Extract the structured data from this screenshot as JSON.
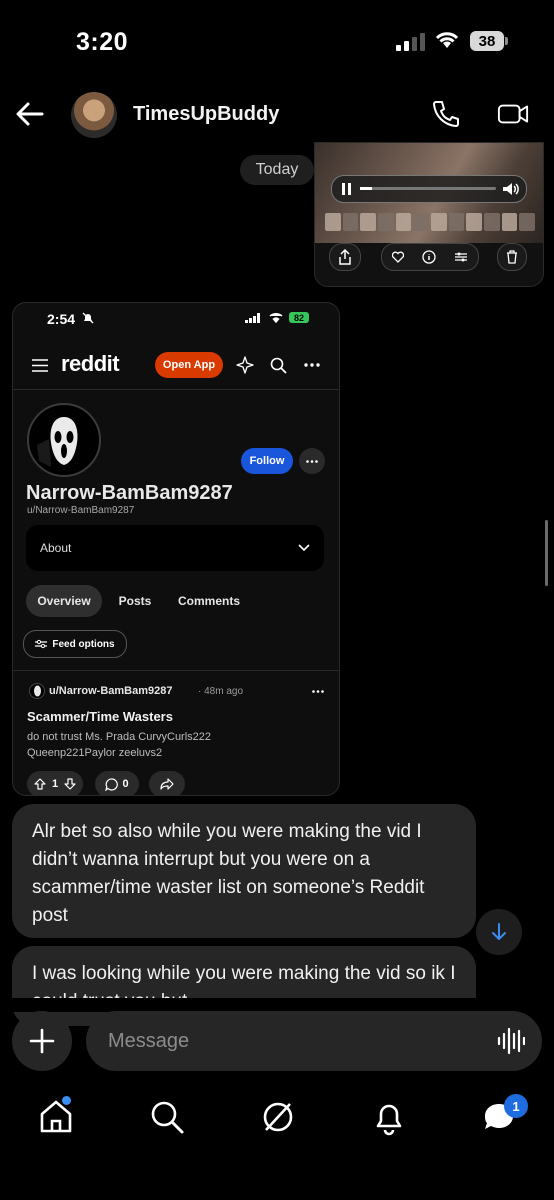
{
  "status_bar": {
    "time": "3:20",
    "battery": "38"
  },
  "header": {
    "contact_name": "TimesUpBuddy"
  },
  "date_divider": "Today",
  "reddit_screenshot": {
    "time": "2:54",
    "battery": "82",
    "logo": "reddit",
    "open_app_label": "Open App",
    "follow_label": "Follow",
    "display_name": "Narrow-BamBam9287",
    "handle": "u/Narrow-BamBam9287",
    "about_label": "About",
    "tabs": [
      "Overview",
      "Posts",
      "Comments"
    ],
    "feed_options_label": "Feed options",
    "post": {
      "author": "u/Narrow-BamBam9287",
      "age": "· 48m ago",
      "title": "Scammer/Time Wasters",
      "body": "do not trust Ms. Prada CurvyCurls222 Queenp221Paylor zeeluvs2",
      "upvotes": "1",
      "comments": "0"
    }
  },
  "messages": [
    "Alr bet so also while you were making the vid I didn’t wanna interrupt but you were on a scammer/time waster list on someone’s Reddit post",
    "I was looking while you were making the vid so ik I could trust you but"
  ],
  "composer": {
    "placeholder": "Message"
  },
  "bottom_nav": {
    "chat_badge": "1"
  },
  "colors": {
    "reddit_orange": "#d93a00",
    "follow_blue": "#1a56db",
    "bubble": "#262626",
    "badge": "#1d6ce0"
  }
}
